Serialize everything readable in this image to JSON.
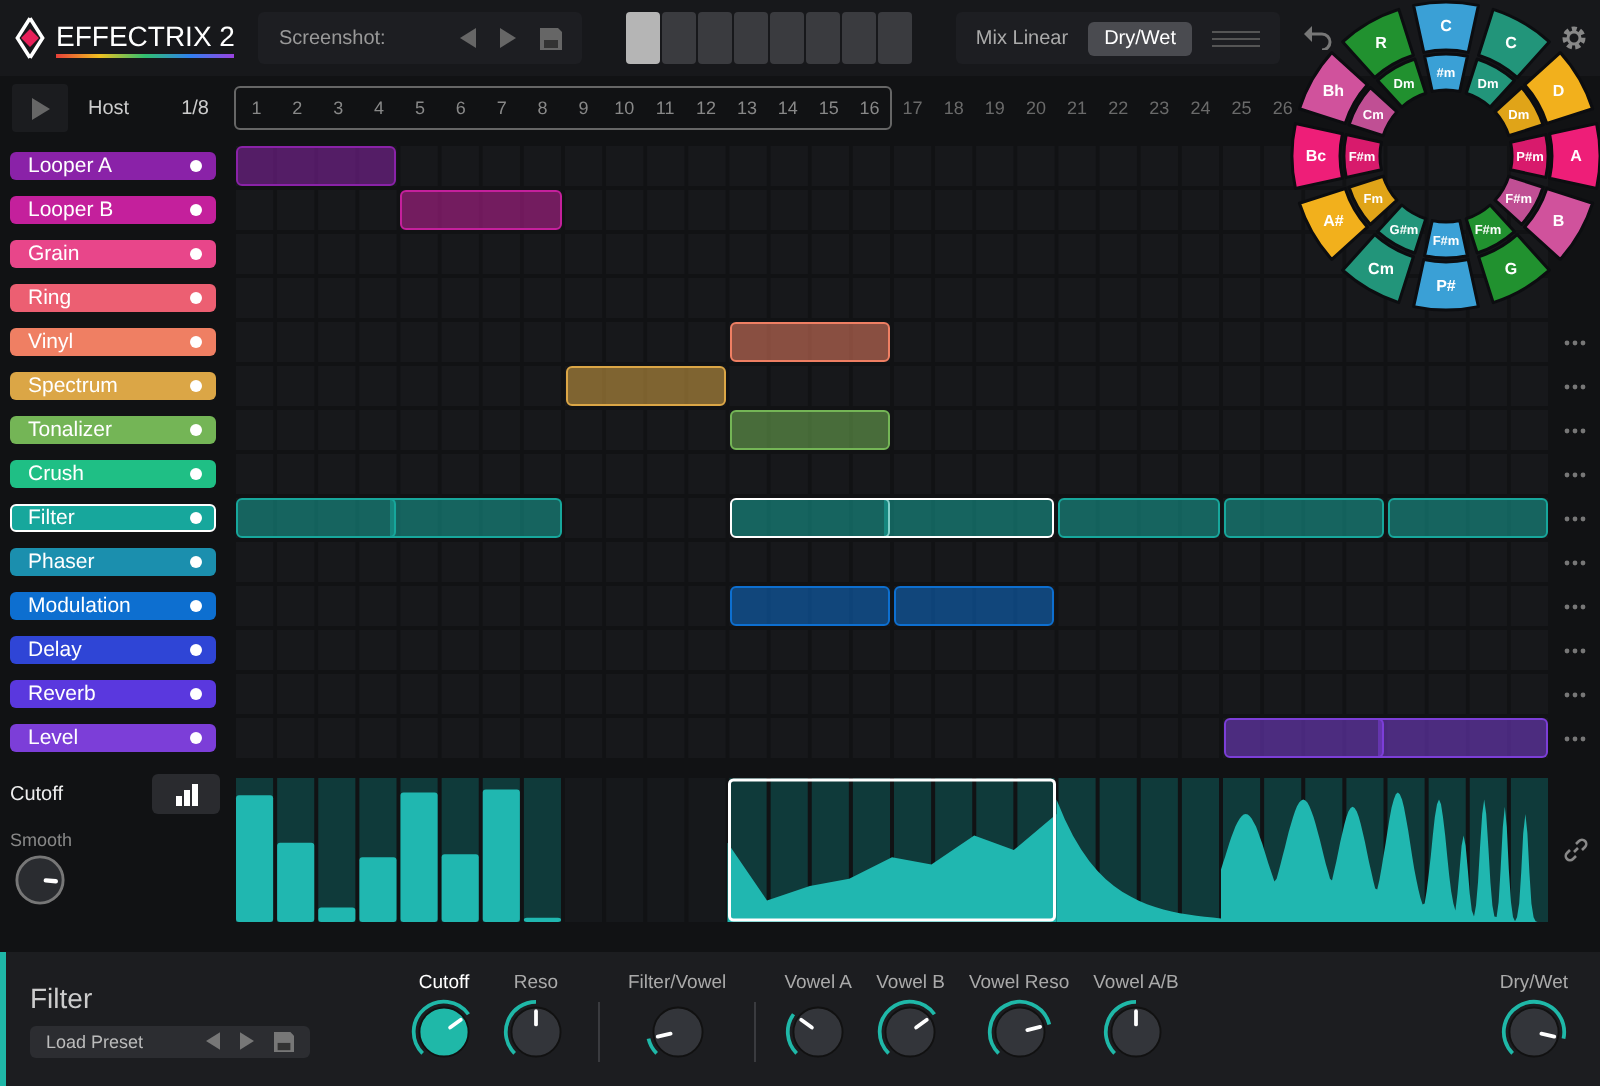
{
  "header": {
    "logo": "EFFECTRIX 2",
    "screenshot_label": "Screenshot:",
    "patterns": [
      {
        "selected": true
      },
      {
        "selected": false
      },
      {
        "selected": false
      },
      {
        "selected": false
      },
      {
        "selected": false
      },
      {
        "selected": false
      },
      {
        "selected": false
      },
      {
        "selected": false
      }
    ],
    "mix_label": "Mix Linear",
    "mode_button": {
      "label": "Dry/Wet",
      "selected": true
    }
  },
  "transport": {
    "sync": "Host",
    "rate": "1/8"
  },
  "steps": [
    {
      "label": "1",
      "in_loop": true
    },
    {
      "label": "2",
      "in_loop": true
    },
    {
      "label": "3",
      "in_loop": true
    },
    {
      "label": "4",
      "in_loop": true
    },
    {
      "label": "5",
      "in_loop": true
    },
    {
      "label": "6",
      "in_loop": true
    },
    {
      "label": "7",
      "in_loop": true
    },
    {
      "label": "8",
      "in_loop": true
    },
    {
      "label": "9",
      "in_loop": true
    },
    {
      "label": "10",
      "in_loop": true
    },
    {
      "label": "11",
      "in_loop": true
    },
    {
      "label": "12",
      "in_loop": true
    },
    {
      "label": "13",
      "in_loop": true
    },
    {
      "label": "14",
      "in_loop": true
    },
    {
      "label": "15",
      "in_loop": true
    },
    {
      "label": "16",
      "in_loop": true
    },
    {
      "label": "17",
      "in_loop": false
    },
    {
      "label": "18",
      "in_loop": false
    },
    {
      "label": "19",
      "in_loop": false
    },
    {
      "label": "20",
      "in_loop": false
    },
    {
      "label": "21",
      "in_loop": false
    },
    {
      "label": "22",
      "in_loop": false
    },
    {
      "label": "23",
      "in_loop": false
    },
    {
      "label": "24",
      "in_loop": false
    },
    {
      "label": "25",
      "in_loop": false
    },
    {
      "label": "26",
      "in_loop": false
    }
  ],
  "tracks": [
    {
      "name": "Looper A",
      "color": "#8a22a8",
      "selected": false,
      "menu_shown": false,
      "bars": [
        {
          "kind": "clip",
          "joined": false,
          "selected": false
        },
        {
          "kind": "empty"
        },
        {
          "kind": "empty"
        },
        {
          "kind": "empty"
        },
        {
          "kind": "empty"
        },
        {
          "kind": "empty"
        },
        {
          "kind": "empty"
        },
        {
          "kind": "empty"
        }
      ]
    },
    {
      "name": "Looper B",
      "color": "#c4209c",
      "selected": false,
      "menu_shown": false,
      "bars": [
        {
          "kind": "empty"
        },
        {
          "kind": "clip",
          "joined": false,
          "selected": false
        },
        {
          "kind": "empty"
        },
        {
          "kind": "empty"
        },
        {
          "kind": "empty"
        },
        {
          "kind": "empty"
        },
        {
          "kind": "empty"
        },
        {
          "kind": "empty"
        }
      ]
    },
    {
      "name": "Grain",
      "color": "#e8468a",
      "selected": false,
      "menu_shown": false,
      "bars": [
        {
          "kind": "empty"
        },
        {
          "kind": "empty"
        },
        {
          "kind": "empty"
        },
        {
          "kind": "empty"
        },
        {
          "kind": "empty"
        },
        {
          "kind": "empty"
        },
        {
          "kind": "empty"
        },
        {
          "kind": "empty"
        }
      ]
    },
    {
      "name": "Ring",
      "color": "#ec5f72",
      "selected": false,
      "menu_shown": false,
      "bars": [
        {
          "kind": "empty"
        },
        {
          "kind": "empty"
        },
        {
          "kind": "empty"
        },
        {
          "kind": "empty"
        },
        {
          "kind": "empty"
        },
        {
          "kind": "empty"
        },
        {
          "kind": "empty"
        },
        {
          "kind": "empty"
        }
      ]
    },
    {
      "name": "Vinyl",
      "color": "#ef7f63",
      "selected": false,
      "menu_shown": true,
      "bars": [
        {
          "kind": "empty"
        },
        {
          "kind": "empty"
        },
        {
          "kind": "empty"
        },
        {
          "kind": "clip",
          "joined": false,
          "selected": false
        },
        {
          "kind": "empty"
        },
        {
          "kind": "empty"
        },
        {
          "kind": "empty"
        },
        {
          "kind": "empty"
        }
      ]
    },
    {
      "name": "Spectrum",
      "color": "#dba646",
      "selected": false,
      "menu_shown": true,
      "bars": [
        {
          "kind": "empty"
        },
        {
          "kind": "empty"
        },
        {
          "kind": "clip",
          "joined": false,
          "selected": false
        },
        {
          "kind": "empty"
        },
        {
          "kind": "empty"
        },
        {
          "kind": "empty"
        },
        {
          "kind": "empty"
        },
        {
          "kind": "empty"
        }
      ]
    },
    {
      "name": "Tonalizer",
      "color": "#74b556",
      "selected": false,
      "menu_shown": true,
      "bars": [
        {
          "kind": "empty"
        },
        {
          "kind": "empty"
        },
        {
          "kind": "empty"
        },
        {
          "kind": "clip",
          "joined": false,
          "selected": false
        },
        {
          "kind": "empty"
        },
        {
          "kind": "empty"
        },
        {
          "kind": "empty"
        },
        {
          "kind": "empty"
        }
      ]
    },
    {
      "name": "Crush",
      "color": "#1fbf85",
      "selected": false,
      "menu_shown": true,
      "bars": [
        {
          "kind": "empty"
        },
        {
          "kind": "empty"
        },
        {
          "kind": "empty"
        },
        {
          "kind": "empty"
        },
        {
          "kind": "empty"
        },
        {
          "kind": "empty"
        },
        {
          "kind": "empty"
        },
        {
          "kind": "empty"
        }
      ]
    },
    {
      "name": "Filter",
      "color": "#17a79c",
      "selected": true,
      "menu_shown": true,
      "bars": [
        {
          "kind": "clip",
          "joined": false,
          "selected": false
        },
        {
          "kind": "clip",
          "joined": true,
          "selected": false
        },
        {
          "kind": "empty"
        },
        {
          "kind": "clip",
          "joined": false,
          "selected": true
        },
        {
          "kind": "clip",
          "joined": true,
          "selected": true
        },
        {
          "kind": "clip",
          "joined": false,
          "selected": false
        },
        {
          "kind": "clip",
          "joined": false,
          "selected": false
        },
        {
          "kind": "clip",
          "joined": false,
          "selected": false
        }
      ]
    },
    {
      "name": "Phaser",
      "color": "#1b8fae",
      "selected": false,
      "menu_shown": true,
      "bars": [
        {
          "kind": "empty"
        },
        {
          "kind": "empty"
        },
        {
          "kind": "empty"
        },
        {
          "kind": "empty"
        },
        {
          "kind": "empty"
        },
        {
          "kind": "empty"
        },
        {
          "kind": "empty"
        },
        {
          "kind": "empty"
        }
      ]
    },
    {
      "name": "Modulation",
      "color": "#0d6fd0",
      "selected": false,
      "menu_shown": true,
      "bars": [
        {
          "kind": "empty"
        },
        {
          "kind": "empty"
        },
        {
          "kind": "empty"
        },
        {
          "kind": "clip",
          "joined": false,
          "selected": false
        },
        {
          "kind": "clip",
          "joined": false,
          "selected": false
        },
        {
          "kind": "empty"
        },
        {
          "kind": "empty"
        },
        {
          "kind": "empty"
        }
      ]
    },
    {
      "name": "Delay",
      "color": "#2f45d6",
      "selected": false,
      "menu_shown": true,
      "bars": [
        {
          "kind": "empty"
        },
        {
          "kind": "empty"
        },
        {
          "kind": "empty"
        },
        {
          "kind": "empty"
        },
        {
          "kind": "empty"
        },
        {
          "kind": "empty"
        },
        {
          "kind": "empty"
        },
        {
          "kind": "empty"
        }
      ]
    },
    {
      "name": "Reverb",
      "color": "#5a38de",
      "selected": false,
      "menu_shown": true,
      "bars": [
        {
          "kind": "empty"
        },
        {
          "kind": "empty"
        },
        {
          "kind": "empty"
        },
        {
          "kind": "empty"
        },
        {
          "kind": "empty"
        },
        {
          "kind": "empty"
        },
        {
          "kind": "empty"
        },
        {
          "kind": "empty"
        }
      ]
    },
    {
      "name": "Level",
      "color": "#7c3ed8",
      "selected": false,
      "menu_shown": true,
      "bars": [
        {
          "kind": "empty"
        },
        {
          "kind": "empty"
        },
        {
          "kind": "empty"
        },
        {
          "kind": "empty"
        },
        {
          "kind": "empty"
        },
        {
          "kind": "empty"
        },
        {
          "kind": "clip",
          "joined": false,
          "selected": false
        },
        {
          "kind": "clip",
          "joined": true,
          "selected": false
        }
      ]
    }
  ],
  "mod_lane": {
    "parameter": "Cutoff",
    "smooth_label": "Smooth"
  },
  "panel": {
    "title": "Filter",
    "preset": "Load Preset",
    "knobs": [
      {
        "label": "Cutoff",
        "selected": true,
        "separator_before": false
      },
      {
        "label": "Reso",
        "selected": false,
        "separator_before": false
      },
      {
        "label": "Filter/Vowel",
        "selected": false,
        "separator_before": true
      },
      {
        "label": "Vowel A",
        "selected": false,
        "separator_before": true
      },
      {
        "label": "Vowel B",
        "selected": false,
        "separator_before": false
      },
      {
        "label": "Vowel Reso",
        "selected": false,
        "separator_before": false
      },
      {
        "label": "Vowel A/B",
        "selected": false,
        "separator_before": false
      }
    ],
    "output_knob": {
      "label": "Dry/Wet",
      "selected": false
    }
  },
  "chord_wheel": {
    "outer": [
      {
        "label": "C",
        "color": "#3aa0d6"
      },
      {
        "label": "C",
        "color": "#22957a"
      },
      {
        "label": "D",
        "color": "#f2b01c"
      },
      {
        "label": "A",
        "color": "#ee1e78"
      },
      {
        "label": "B",
        "color": "#d0529c"
      },
      {
        "label": "G",
        "color": "#21912f"
      },
      {
        "label": "P#",
        "color": "#3aa0d6"
      },
      {
        "label": "Cm",
        "color": "#22957a"
      },
      {
        "label": "A#",
        "color": "#f2b01c"
      },
      {
        "label": "Bc",
        "color": "#ee1e78"
      },
      {
        "label": "Bh",
        "color": "#d0529c"
      },
      {
        "label": "R",
        "color": "#21912f"
      }
    ],
    "inner": [
      {
        "label": "#m",
        "color": "#3aa0d6"
      },
      {
        "label": "Dm",
        "color": "#22957a"
      },
      {
        "label": "Dm",
        "color": "#e0a418"
      },
      {
        "label": "P#m",
        "color": "#d81a6c"
      },
      {
        "label": "F#m",
        "color": "#c04f94"
      },
      {
        "label": "F#m",
        "color": "#21912f"
      },
      {
        "label": "F#m",
        "color": "#3aa0d6"
      },
      {
        "label": "G#m",
        "color": "#22957a"
      },
      {
        "label": "Fm",
        "color": "#e0a418"
      },
      {
        "label": "F#m",
        "color": "#d81a6c"
      },
      {
        "label": "Cm",
        "color": "#c04f94"
      },
      {
        "label": "Dm",
        "color": "#21912f"
      }
    ]
  }
}
